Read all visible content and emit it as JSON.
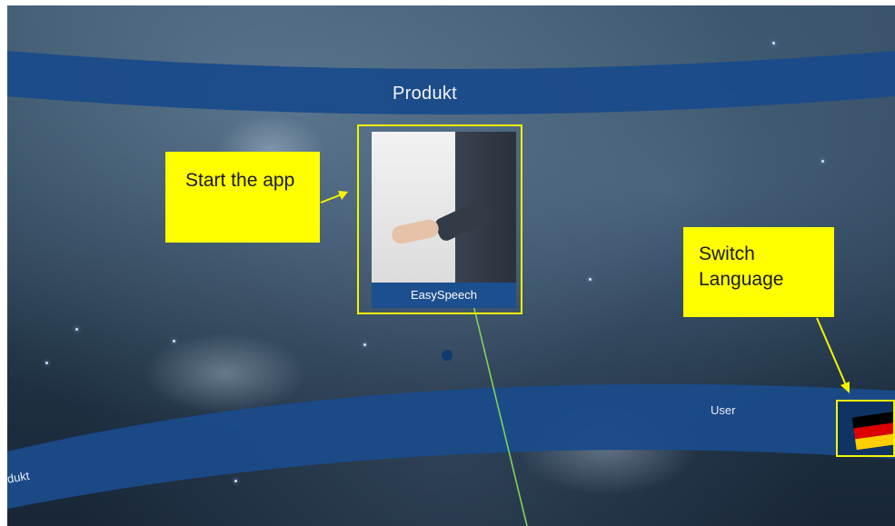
{
  "screen": {
    "top_band_title": "Produkt",
    "bottom_band_left_label": "dukt",
    "bottom_band_user_label": "User"
  },
  "app_tile": {
    "caption": "EasySpeech"
  },
  "callouts": {
    "start_app": "Start the app",
    "switch_language": "Switch Language"
  },
  "language_flag": {
    "icon": "germany-flag-icon",
    "stripes": [
      "#000000",
      "#dd0000",
      "#ffce00"
    ]
  },
  "colors": {
    "band": "#1a4b8a",
    "highlight": "#ffff00",
    "pointer_ray": "#7fd35a"
  }
}
